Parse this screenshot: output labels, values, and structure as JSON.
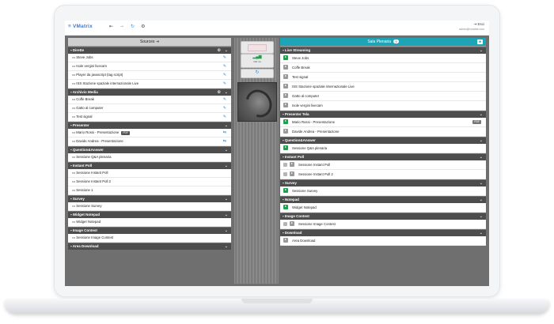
{
  "app": {
    "brand": "VMatrix"
  },
  "toolbar": {
    "icon_a": "⇤",
    "icon_b": "→",
    "icon_c": "↻",
    "icon_d": "⚙"
  },
  "user": {
    "name": "Esci",
    "sub": "admin@vmatrix.com"
  },
  "sources": {
    "title": "Sources",
    "sections": [
      {
        "title": "Dirette",
        "has_gear": true,
        "items": [
          {
            "label": "Steve Jobs",
            "action": "edit"
          },
          {
            "label": "Isole vergini livecam",
            "action": "edit"
          },
          {
            "label": "Player da javascript (tag script)",
            "action": "edit"
          },
          {
            "label": "ISS Stazione spaziale internazionale Live",
            "action": "edit"
          }
        ]
      },
      {
        "title": "Archivio Media",
        "has_gear": true,
        "items": [
          {
            "label": "Coffe Break",
            "action": "edit"
          },
          {
            "label": "Gatto al computer",
            "action": "edit"
          },
          {
            "label": "Test signal",
            "action": "edit"
          }
        ]
      },
      {
        "title": "Presenter",
        "has_gear": false,
        "items": [
          {
            "label": "Mario Rossi - Presentazione",
            "tag": "PDF",
            "action": "link"
          },
          {
            "label": "Davide Andrea - Presentazione",
            "action": "link"
          }
        ]
      },
      {
        "title": "Question&Answer",
        "has_gear": false,
        "items": [
          {
            "label": "Sessione Q&A plenaria"
          }
        ]
      },
      {
        "title": "Instant Poll",
        "has_gear": false,
        "items": [
          {
            "label": "Sessione Instant Poll"
          },
          {
            "label": "Sessione Instant Poll 2"
          },
          {
            "label": "Sessione 1"
          }
        ]
      },
      {
        "title": "Survey",
        "has_gear": false,
        "items": [
          {
            "label": "Sessione Survey"
          }
        ]
      },
      {
        "title": "Widget Notepad",
        "has_gear": false,
        "items": [
          {
            "label": "Widget Notepad"
          }
        ]
      },
      {
        "title": "Image Contest",
        "has_gear": false,
        "items": [
          {
            "label": "Sessione Image Contest"
          }
        ]
      },
      {
        "title": "Area Download",
        "has_gear": false,
        "items": []
      }
    ]
  },
  "center": {
    "signal_label": "100 ms"
  },
  "room": {
    "title": "Sala Plenaria",
    "count": "0",
    "sections": [
      {
        "title": "Live Streaming",
        "items": [
          {
            "label": "Steve Jobs",
            "active": true
          },
          {
            "label": "Coffe Break",
            "active": false
          },
          {
            "label": "Test signal",
            "active": false
          },
          {
            "label": "ISS Stazione spaziale internazionale Live",
            "active": false
          },
          {
            "label": "Gatto al computer",
            "active": false
          },
          {
            "label": "Isole vergini livecam",
            "active": false
          }
        ]
      },
      {
        "title": "Presenter Tela",
        "items": [
          {
            "label": "Mario Rossi - Presentazione",
            "active": true,
            "tag": "PDF"
          },
          {
            "label": "Davide Andrea - Presentazione",
            "active": false
          }
        ]
      },
      {
        "title": "Question&Answer",
        "items": [
          {
            "label": "Sessione Q&A plenaria",
            "active": true
          }
        ]
      },
      {
        "title": "Instant Poll",
        "items": [
          {
            "label": "Sessione Instant Poll",
            "active": false,
            "mini": true
          },
          {
            "label": "Sessione Instant Poll 2",
            "active": false,
            "mini": true
          }
        ]
      },
      {
        "title": "Survey",
        "items": [
          {
            "label": "Sessione Survey",
            "active": true
          }
        ]
      },
      {
        "title": "Notepad",
        "items": [
          {
            "label": "Widget Notepad",
            "active": true
          }
        ]
      },
      {
        "title": "Image Contest",
        "items": [
          {
            "label": "Sessione Image Contest",
            "active": false,
            "mini": true
          }
        ]
      },
      {
        "title": "Download",
        "items": [
          {
            "label": "Area Download",
            "active": false
          }
        ]
      }
    ]
  }
}
